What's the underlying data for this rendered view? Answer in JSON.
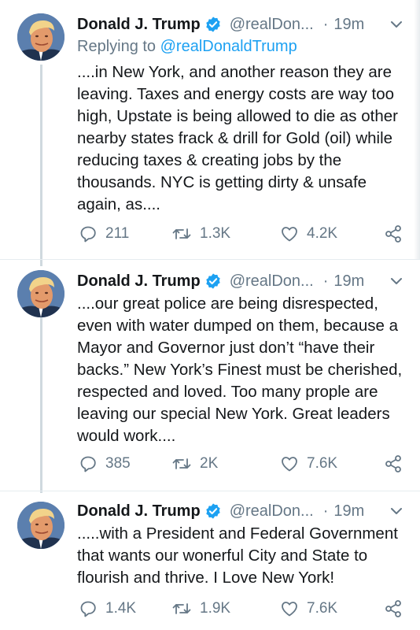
{
  "tweets": [
    {
      "author": {
        "display_name": "Donald J. Trump",
        "handle": "@realDon...",
        "verified": true
      },
      "time": "19m",
      "replying_prefix": "Replying to ",
      "replying_to": "@realDonaldTrump",
      "text": "....in New York, and another reason they are leaving. Taxes and energy costs are way too high, Upstate is being allowed to die as other nearby states frack & drill for Gold (oil) while reducing taxes & creating jobs by the thousands. NYC is getting dirty & unsafe again, as....",
      "stats": {
        "replies": "211",
        "retweets": "1.3K",
        "likes": "4.2K"
      }
    },
    {
      "author": {
        "display_name": "Donald J. Trump",
        "handle": "@realDon...",
        "verified": true
      },
      "time": "19m",
      "text": "....our great police are being disrespected, even with water dumped on them, because a Mayor and Governor just don’t “have their backs.” New York’s Finest must be cherished, respected and loved. Too many prople are leaving our special New York. Great leaders would work....",
      "stats": {
        "replies": "385",
        "retweets": "2K",
        "likes": "7.6K"
      }
    },
    {
      "author": {
        "display_name": "Donald J. Trump",
        "handle": "@realDon...",
        "verified": true
      },
      "time": "19m",
      "text": ".....with a President and Federal Government that wants our wonerful City and State to flourish and thrive. I Love New York!",
      "stats": {
        "replies": "1.4K",
        "retweets": "1.9K",
        "likes": "7.6K"
      }
    }
  ],
  "separator": "·",
  "icons": {
    "verified": "verified-badge-icon",
    "menu": "chevron-down-icon",
    "reply": "reply-icon",
    "retweet": "retweet-icon",
    "like": "heart-icon",
    "share": "share-icon"
  },
  "colors": {
    "text": "#14171a",
    "secondary": "#657786",
    "accent": "#1da1f2",
    "thread_line": "#cfd9de"
  }
}
